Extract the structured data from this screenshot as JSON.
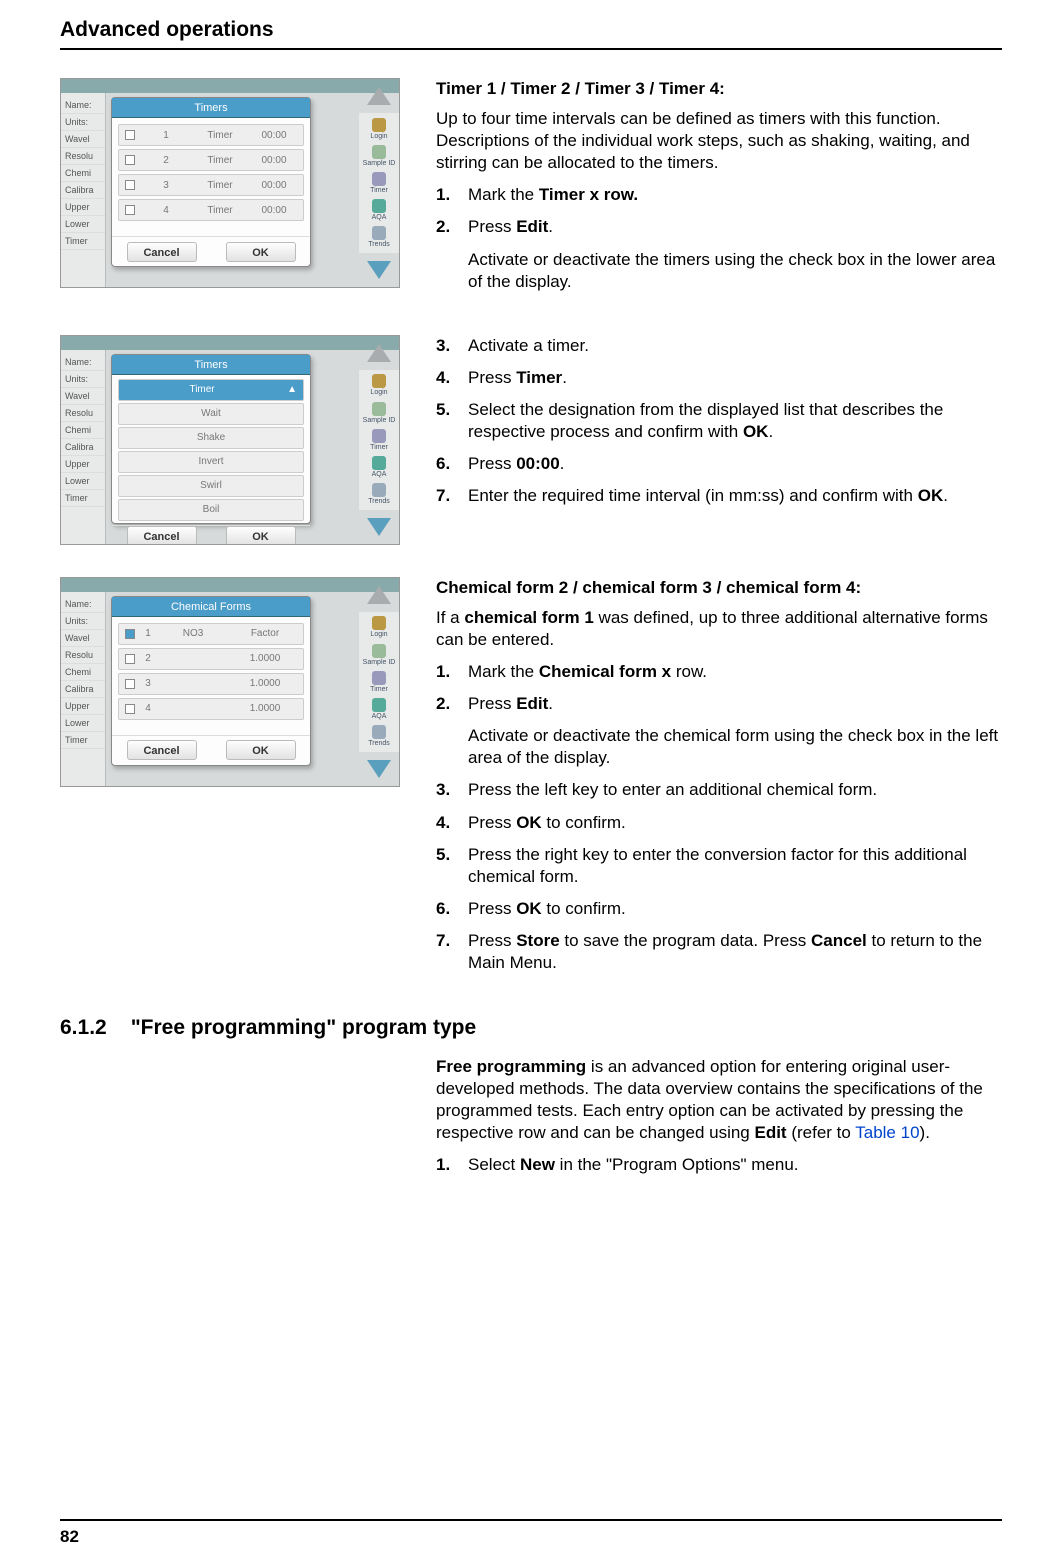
{
  "header": "Advanced operations",
  "page_number": "82",
  "mock_labels": {
    "left": [
      "Name:",
      "Units:",
      "Wavel",
      "Resolu",
      "Chemi",
      "Calibra",
      "Upper",
      "Lower",
      "Timer"
    ],
    "side_icons": [
      "Login",
      "Sample ID",
      "Timer",
      "AQA",
      "Trends"
    ],
    "cancel": "Cancel",
    "ok": "OK"
  },
  "mock1": {
    "title": "Timers",
    "rows": [
      {
        "n": "1",
        "a": "Timer",
        "b": "00:00"
      },
      {
        "n": "2",
        "a": "Timer",
        "b": "00:00"
      },
      {
        "n": "3",
        "a": "Timer",
        "b": "00:00"
      },
      {
        "n": "4",
        "a": "Timer",
        "b": "00:00"
      }
    ]
  },
  "mock2": {
    "title": "Timers",
    "toprow": "Timer",
    "rows": [
      "Wait",
      "Shake",
      "Invert",
      "Swirl",
      "Boil"
    ]
  },
  "mock3": {
    "title": "Chemical Forms",
    "rows": [
      {
        "n": "1",
        "a": "NO3",
        "b": "Factor"
      },
      {
        "n": "2",
        "a": "",
        "b": "1.0000"
      },
      {
        "n": "3",
        "a": "",
        "b": "1.0000"
      },
      {
        "n": "4",
        "a": "",
        "b": "1.0000"
      }
    ]
  },
  "b1": {
    "head": "Timer 1 / Timer 2 / Timer 3 / Timer 4:",
    "intro": "Up to four time intervals can be defined as timers with this function. Descriptions of the individual work steps, such as shaking, waiting, and stirring can be allocated to the timers.",
    "s1a": "Mark the ",
    "s1b": "Timer x row.",
    "s2a": "Press ",
    "s2b": "Edit",
    "s2c": ".",
    "s2sub": "Activate or deactivate the timers using the check box in the lower area of the display."
  },
  "b2": {
    "s3": "Activate a timer.",
    "s4a": "Press ",
    "s4b": "Timer",
    "s4c": ".",
    "s5a": "Select the designation from the displayed list that describes the respective process and confirm with ",
    "s5b": "OK",
    "s5c": ".",
    "s6a": "Press ",
    "s6b": "00:00",
    "s6c": ".",
    "s7a": "Enter the required time interval (in mm:ss) and confirm with ",
    "s7b": "OK",
    "s7c": "."
  },
  "b3": {
    "head": "Chemical form 2 / chemical form 3 / chemical form 4:",
    "intro_a": "If a ",
    "intro_b": "chemical form 1",
    "intro_c": " was defined, up to three additional alternative forms can be entered.",
    "s1a": "Mark the ",
    "s1b": "Chemical form x",
    "s1c": " row.",
    "s2a": "Press ",
    "s2b": "Edit",
    "s2c": ".",
    "s2sub": "Activate or deactivate the chemical form using the check box in the left area of the display.",
    "s3": "Press the left key to enter an additional chemical form.",
    "s4a": "Press ",
    "s4b": "OK",
    "s4c": " to confirm.",
    "s5": "Press the right key to enter the conversion factor for this additional chemical form.",
    "s6a": "Press ",
    "s6b": "OK",
    "s6c": " to confirm.",
    "s7a": "Press ",
    "s7b": "Store",
    "s7c": " to save the program data. Press ",
    "s7d": "Cancel",
    "s7e": " to return to the Main Menu."
  },
  "sec612": {
    "num": "6.1.2",
    "title": "\"Free programming\" program type",
    "p_a": "Free programming",
    "p_b": " is an advanced option for entering original user-developed methods. The data overview contains the specifications of the programmed tests. Each entry option can be activated by pressing the respective row and can be changed using ",
    "p_c": "Edit",
    "p_d": " (refer to ",
    "p_e": "Table 10",
    "p_f": ").",
    "s1a": "Select ",
    "s1b": "New",
    "s1c": " in the \"Program Options\" menu."
  }
}
